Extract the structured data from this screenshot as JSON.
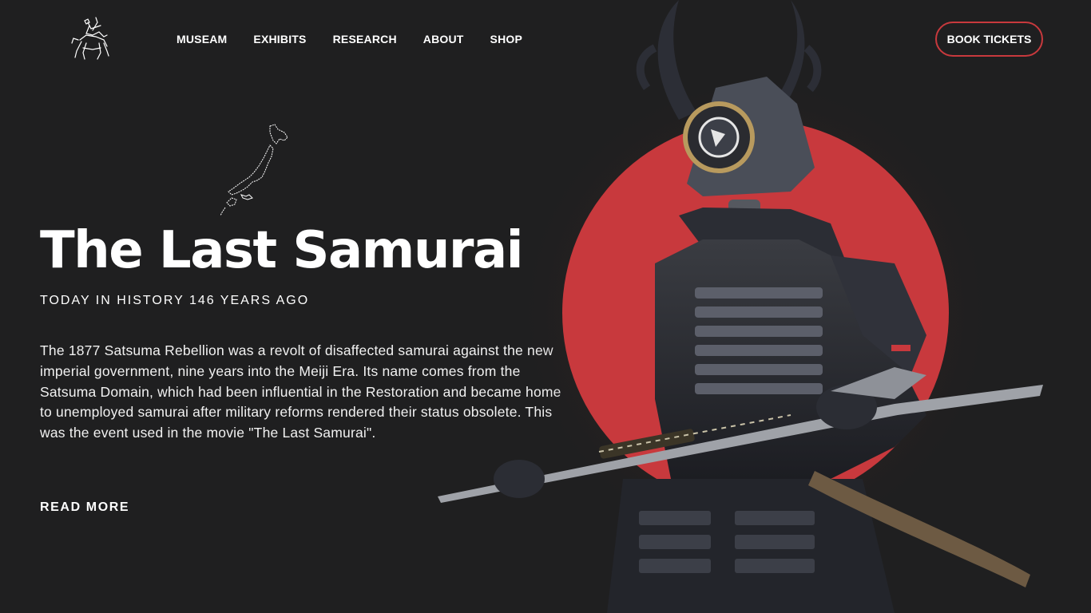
{
  "nav": {
    "items": [
      "MUSEAM",
      "EXHIBITS",
      "RESEARCH",
      "ABOUT",
      "SHOP"
    ]
  },
  "header": {
    "cta_label": "BOOK TICKETS",
    "logo_icon": "samurai-horseman-logo"
  },
  "hero": {
    "title": "The Last Samurai",
    "subtitle": "TODAY IN HISTORY 146 YEARS AGO",
    "body": "The 1877 Satsuma Rebellion was a revolt of disaffected samurai against the new imperial government, nine years into the Meiji Era. Its name comes from the Satsuma Domain, which had been influential in the Restoration and became home to unemployed samurai after military reforms rendered their status obsolete. This was the event used in the movie \"The Last Samurai\".",
    "read_more": "READ MORE",
    "map_icon": "japan-map-outline",
    "image": "samurai-armor-with-rising-sun"
  },
  "colors": {
    "background": "#1f1f20",
    "accent_red": "#c8393d",
    "text": "#ffffff"
  }
}
